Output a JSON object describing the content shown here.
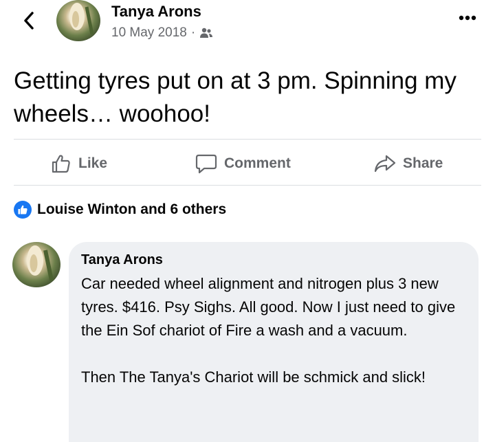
{
  "header": {
    "author_name": "Tanya Arons",
    "date": "10 May 2018",
    "separator": "·",
    "audience_icon": "friends-icon",
    "back_icon": "chevron-left-icon",
    "more_icon": "more-dots-icon"
  },
  "post": {
    "text": "Getting tyres put on at 3 pm.  Spinning my wheels…  woohoo!"
  },
  "actions": {
    "like_label": "Like",
    "comment_label": "Comment",
    "share_label": "Share"
  },
  "reactions": {
    "summary": "Louise Winton and 6 others",
    "icon": "like-badge-icon",
    "color": "#1877f2"
  },
  "comment": {
    "author_name": "Tanya Arons",
    "text": "Car needed wheel alignment and nitrogen plus 3 new tyres.  $416.  Psy Sighs.  All good.  Now I just need to give the Ein Sof chariot of Fire a wash and a vacuum.\n\nThen The Tanya's Chariot will be schmick and slick!"
  },
  "colors": {
    "text_primary": "#050505",
    "text_secondary": "#65676b",
    "divider": "#dadde1",
    "comment_bg": "#eef0f3",
    "accent": "#1877f2"
  }
}
